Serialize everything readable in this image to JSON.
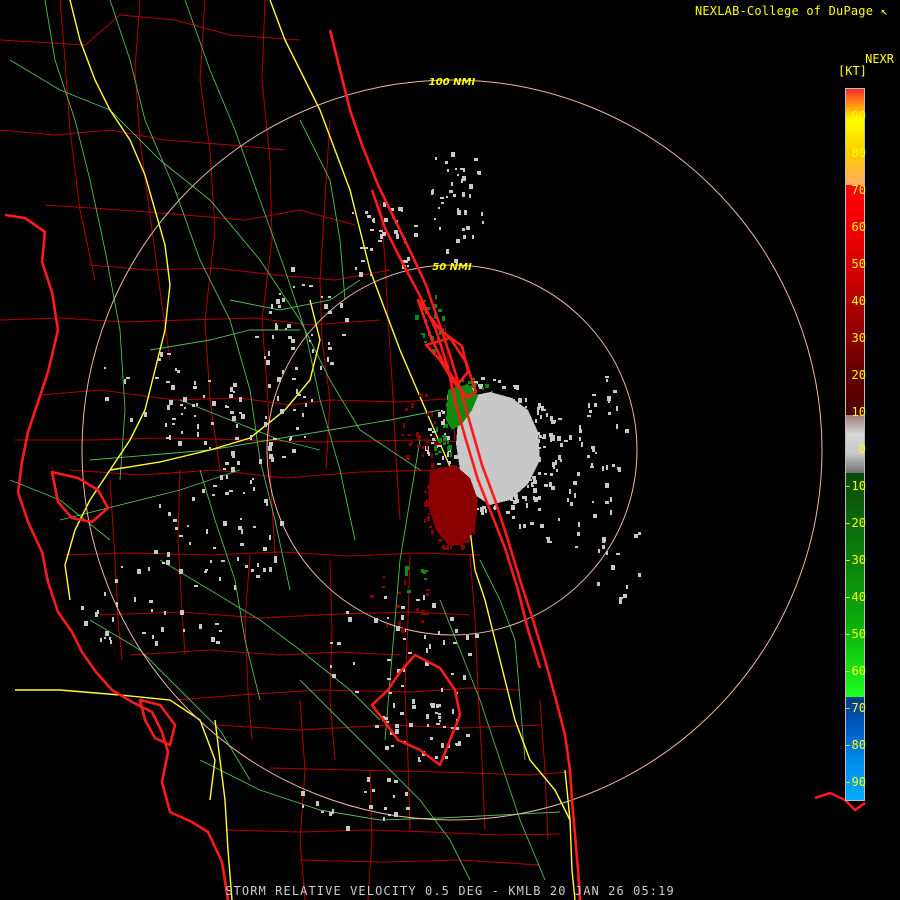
{
  "header": {
    "credit": "NEXLAB-College of DuPage ↖",
    "product_code": "NEXR"
  },
  "legend": {
    "unit": "[KT]",
    "ticks": [
      "90",
      "80",
      "70",
      "60",
      "50",
      "40",
      "30",
      "20",
      "10",
      "0",
      "-10",
      "-20",
      "-30",
      "-40",
      "-50",
      "-60",
      "-70",
      "-80",
      "-90"
    ]
  },
  "range_rings": {
    "inner_label": "50 NMI",
    "outer_label": "100 NMI"
  },
  "footer": {
    "caption": "STORM RELATIVE VELOCITY 0.5 DEG - KMLB 20 JAN 26 05:19"
  },
  "colors": {
    "coast": "#ff1a1a",
    "county_border": "#b50000",
    "highway": "#ffff33",
    "road": "#66cc66",
    "range_ring": "#e8b8a0",
    "inbound_green": "#0e8a0e",
    "outbound_red": "#8a0000",
    "near_zero": "#c8c8c8"
  }
}
